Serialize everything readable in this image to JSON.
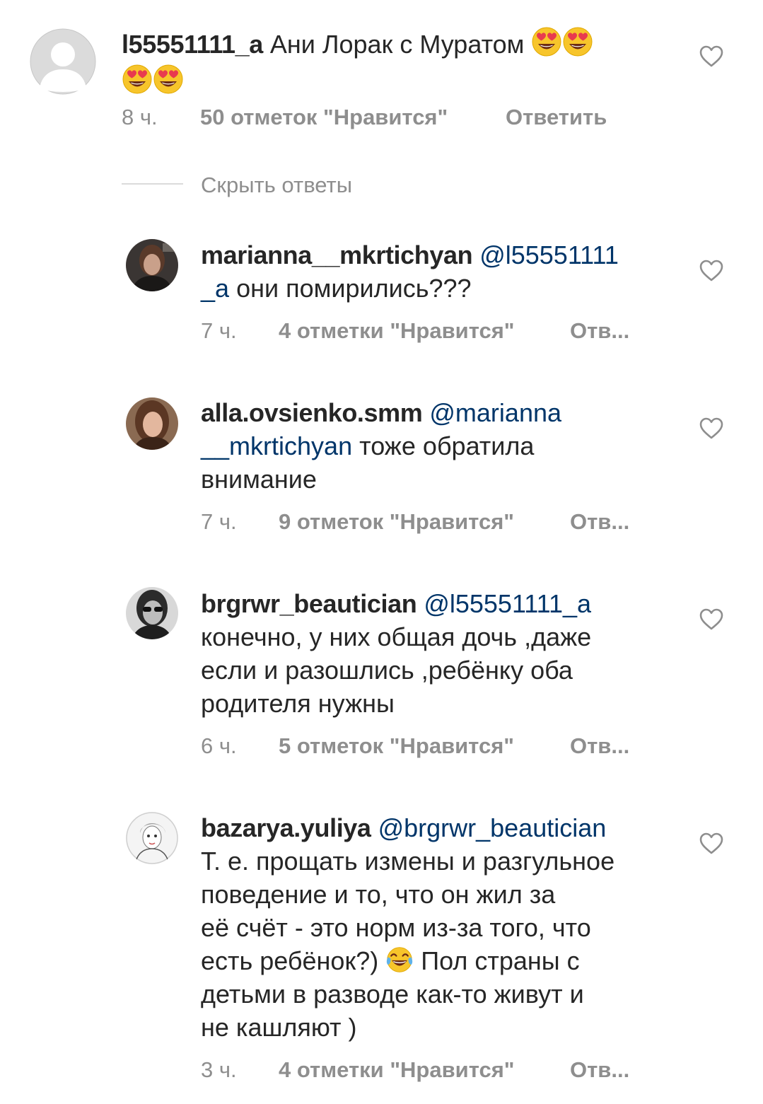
{
  "main_comment": {
    "username": "l55551111_a",
    "text": "Ани Лорак с Муратом",
    "emojis": [
      "heart-eyes-emoji",
      "heart-eyes-emoji",
      "heart-eyes-emoji",
      "heart-eyes-emoji"
    ],
    "time": "8 ч.",
    "likes": "50 отметок \"Нравится\"",
    "reply": "Ответить"
  },
  "hide_replies_label": "Скрыть ответы",
  "replies": [
    {
      "username": "marianna__mkrtichyan",
      "mention_part1": "@l55551111",
      "mention_part2": "_a",
      "text": "они помирились???",
      "time": "7 ч.",
      "likes": "4 отметки \"Нравится\"",
      "reply": "Отв..."
    },
    {
      "username": "alla.ovsienko.smm",
      "mention_part1": "@marianna",
      "mention_part2": "__mkrtichyan",
      "text_line2": "тоже обратила",
      "text_line3": "внимание",
      "time": "7 ч.",
      "likes": "9 отметок \"Нравится\"",
      "reply": "Отв..."
    },
    {
      "username": "brgrwr_beautician",
      "mention": "@l55551111_a",
      "line2": "конечно, у них общая дочь ,даже",
      "line3": "если и разошлись ,ребёнку оба",
      "line4": "родителя нужны",
      "time": "6 ч.",
      "likes": "5 отметок \"Нравится\"",
      "reply": "Отв..."
    },
    {
      "username": "bazarya.yuliya",
      "mention": "@brgrwr_beautician",
      "line2": "Т. е. прощать измены и разгульное",
      "line3": "поведение и то, что он жил за",
      "line4": "её счёт - это норм из-за того, что",
      "line5a": "есть ребёнок?)",
      "emoji": "tears-of-joy-emoji",
      "line5b": "Пол страны с",
      "line6": "детьми в разводе как-то живут и",
      "line7": "не кашляют )",
      "time": "3 ч.",
      "likes": "4 отметки \"Нравится\"",
      "reply": "Отв..."
    }
  ],
  "colors": {
    "text": "#262626",
    "secondary": "#8e8e8e",
    "mention": "#003569",
    "divider": "#dbdbdb",
    "emoji_face": "#f7c52b",
    "emoji_heart": "#e83a4f"
  }
}
